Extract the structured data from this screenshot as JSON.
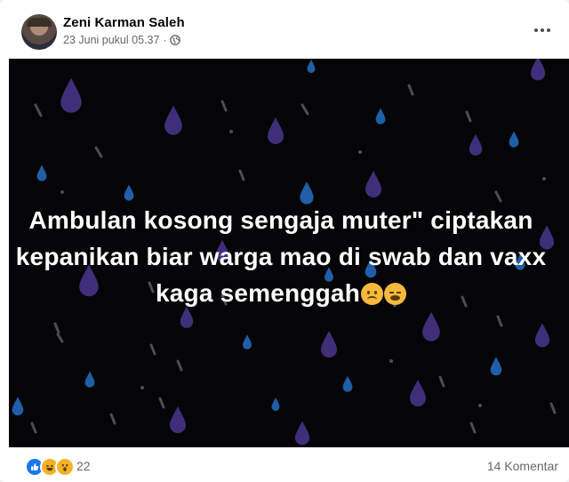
{
  "post": {
    "author": "Zeni Karman Saleh",
    "date": "23 Juni pukul 05.37",
    "separator": "·",
    "privacy_icon": "globe-icon",
    "menu_icon": "more-horizontal-icon",
    "image_text": {
      "line1": "Ambulan kosong sengaja muter\" ciptakan",
      "line2": "kepanikan biar warga mao di swab dan vaxx",
      "line3": "kaga semenggah"
    },
    "image_emojis": [
      "frowning-face-icon",
      "tired-face-icon"
    ],
    "background_theme": "falling rain drops on black"
  },
  "footer": {
    "reaction_icons": [
      "like-icon",
      "haha-icon",
      "wow-icon"
    ],
    "reaction_count": "22",
    "comment_count": "14 Komentar"
  },
  "colors": {
    "image_background": "#050507",
    "drop_purple": "#3f2f7a",
    "drop_blue": "#1f5fa8",
    "drop_grey": "#4a4e56",
    "text_secondary": "#65676b",
    "facebook_blue": "#1877f2"
  }
}
